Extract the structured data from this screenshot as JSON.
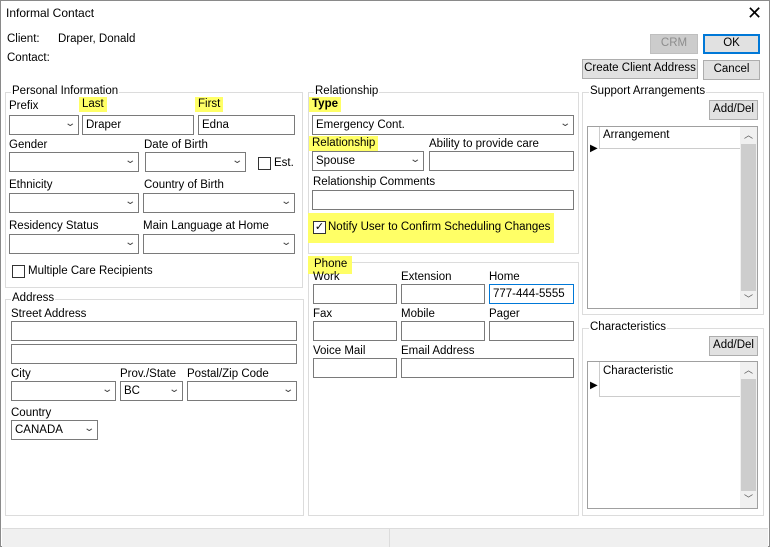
{
  "title": "Informal Contact",
  "header": {
    "client_label": "Client:",
    "client_value": "Draper, Donald",
    "contact_label": "Contact:",
    "contact_value": ""
  },
  "buttons": {
    "crm": "CRM",
    "ok": "OK",
    "create_client_address": "Create Client Address",
    "cancel": "Cancel"
  },
  "personal": {
    "group": "Personal Information",
    "prefix": "Prefix",
    "prefix_value": "",
    "last": "Last",
    "last_value": "Draper",
    "first": "First",
    "first_value": "Edna",
    "gender": "Gender",
    "dob": "Date of Birth",
    "est": "Est.",
    "ethnicity": "Ethnicity",
    "country_birth": "Country of Birth",
    "residency": "Residency Status",
    "language": "Main Language at Home",
    "multiple": "Multiple Care Recipients"
  },
  "address": {
    "group": "Address",
    "street": "Street Address",
    "city": "City",
    "prov": "Prov./State",
    "prov_value": "BC",
    "postal": "Postal/Zip Code",
    "country": "Country",
    "country_value": "CANADA"
  },
  "relationship": {
    "group": "Relationship",
    "type": "Type",
    "type_value": "Emergency Cont.",
    "relationship": "Relationship",
    "relationship_value": "Spouse",
    "ability": "Ability to provide care",
    "comments": "Relationship Comments",
    "notify": "Notify User to Confirm Scheduling Changes",
    "notify_checked": true
  },
  "phone": {
    "group": "Phone",
    "work": "Work",
    "extension": "Extension",
    "home": "Home",
    "home_value": "777-444-5555",
    "fax": "Fax",
    "mobile": "Mobile",
    "pager": "Pager",
    "voice_mail": "Voice Mail",
    "email": "Email Address"
  },
  "support": {
    "group": "Support Arrangements",
    "add_del": "Add/Del",
    "column": "Arrangement"
  },
  "characteristics": {
    "group": "Characteristics",
    "add_del": "Add/Del",
    "column": "Characteristic"
  },
  "colors": {
    "highlight": "#ffff66",
    "focus": "#0078d7"
  }
}
